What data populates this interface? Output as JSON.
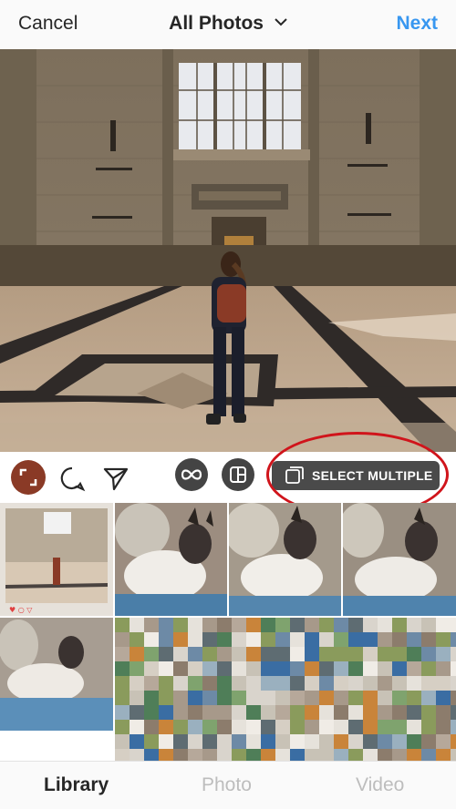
{
  "nav": {
    "cancel_label": "Cancel",
    "title": "All Photos",
    "next_label": "Next"
  },
  "actions": {
    "select_multiple_label": "SELECT MULTIPLE"
  },
  "tabs": [
    {
      "label": "Library",
      "active": true
    },
    {
      "label": "Photo",
      "active": false
    },
    {
      "label": "Video",
      "active": false
    }
  ],
  "colors": {
    "accent": "#3897f0",
    "highlight": "#d0141b",
    "button_bg": "#444444"
  },
  "icons": [
    "chevron-down-icon",
    "expand-icon",
    "comment-icon",
    "send-icon",
    "boomerang-icon",
    "layout-icon",
    "select-multiple-icon"
  ]
}
